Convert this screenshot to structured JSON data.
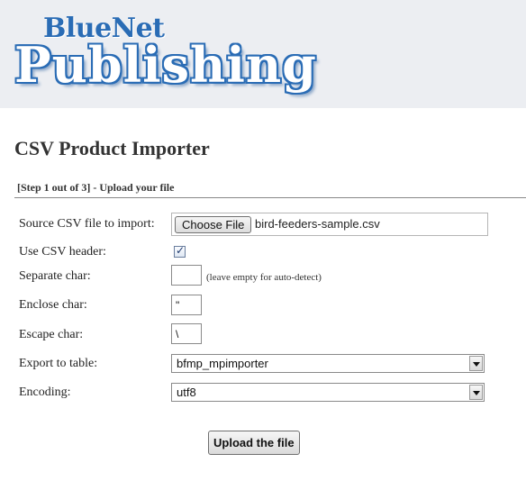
{
  "brand": {
    "line1": "BlueNet",
    "line2": "Publishing"
  },
  "page": {
    "title": "CSV Product Importer",
    "step": "[Step 1 out of 3] - Upload your file"
  },
  "form": {
    "source": {
      "label": "Source CSV file to import:",
      "button": "Choose File",
      "file": "bird-feeders-sample.csv"
    },
    "header": {
      "label": "Use CSV header:",
      "checked": true
    },
    "separate": {
      "label": "Separate char:",
      "value": "",
      "hint": "(leave empty for auto-detect)"
    },
    "enclose": {
      "label": "Enclose char:",
      "value": "\""
    },
    "escape": {
      "label": "Escape char:",
      "value": "\\"
    },
    "export": {
      "label": "Export to table:",
      "value": "bfmp_mpimporter"
    },
    "encoding": {
      "label": "Encoding:",
      "value": "utf8"
    },
    "submit": "Upload the file"
  },
  "colors": {
    "brand_blue": "#2a6cb5",
    "banner_bg": "#eceef2"
  }
}
